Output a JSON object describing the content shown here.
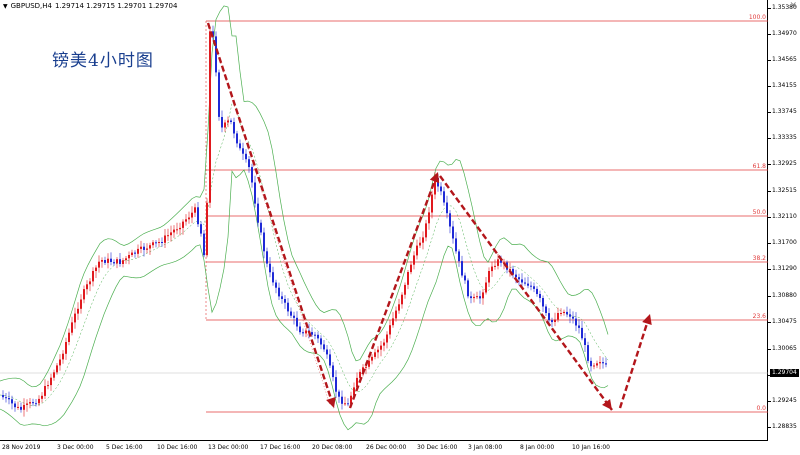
{
  "header": {
    "symbol": "GBPUSD,H4",
    "ohlc": "1.29714 1.29715 1.29701 1.29704"
  },
  "watermark": "镑美4小时图",
  "price_axis": {
    "ticks": [
      "1.35380",
      "1.34970",
      "1.34565",
      "1.34155",
      "1.33745",
      "1.33335",
      "1.32925",
      "1.32515",
      "1.32110",
      "1.31700",
      "1.31290",
      "1.30880",
      "1.30475",
      "1.30065",
      "1.29655",
      "1.29245",
      "1.28835"
    ],
    "current_price": "1.29704"
  },
  "time_axis": {
    "labels": [
      "28 Nov 2019",
      "3 Dec 00:00",
      "5 Dec 16:00",
      "10 Dec 16:00",
      "13 Dec 00:00",
      "17 Dec 16:00",
      "20 Dec 08:00",
      "26 Dec 00:00",
      "30 Dec 16:00",
      "3 Jan 08:00",
      "8 Jan 00:00",
      "10 Jan 16:00"
    ]
  },
  "fibonacci": {
    "levels": [
      "100.0",
      "61.8",
      "50.0",
      "38.2",
      "23.6",
      "0.0"
    ],
    "color": "#e03c3c"
  },
  "colors": {
    "bull": "#e0191e",
    "bear": "#1f2ad6",
    "band": "#4caf50",
    "arrow": "#b3161b"
  }
}
